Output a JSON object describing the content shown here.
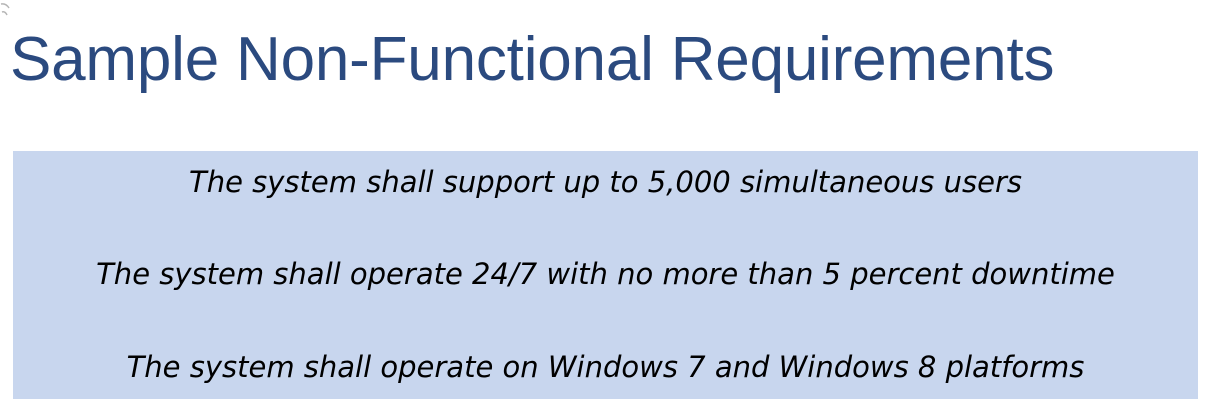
{
  "slide": {
    "title": "Sample Non-Functional Requirements",
    "title_color": "#2b4a7f",
    "box_color": "#c8d6ee",
    "requirements": [
      "The system shall support up to 5,000 simultaneous users",
      "The system shall operate 24/7 with no more than 5 percent downtime",
      "The system shall operate on Windows 7 and Windows 8 platforms"
    ]
  }
}
